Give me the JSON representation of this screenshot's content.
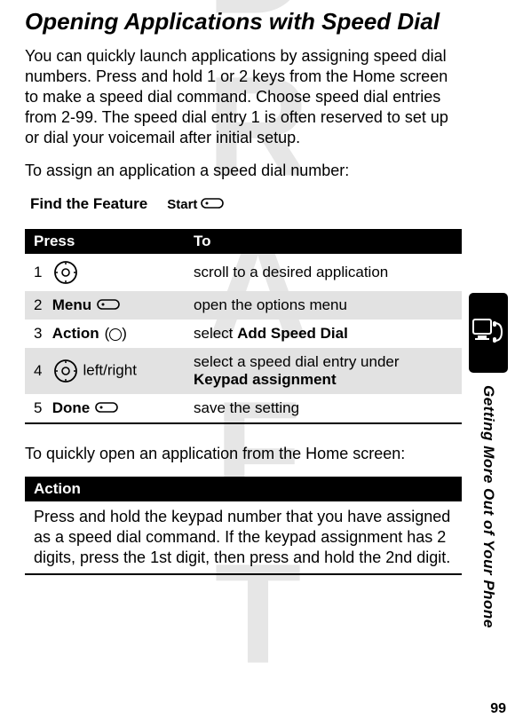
{
  "watermark": "DRAFT",
  "title": "Opening Applications with Speed Dial",
  "intro": "You can quickly launch applications by assigning speed dial numbers. Press and hold 1 or 2 keys from the Home screen to make a speed dial command. Choose speed dial entries from 2-99. The speed dial entry 1 is often reserved to set up or dial your voicemail after initial setup.",
  "assignLine": "To assign an application a speed dial number:",
  "feature": {
    "label": "Find the Feature",
    "start": "Start"
  },
  "table": {
    "headers": {
      "press": "Press",
      "to": "To"
    },
    "rows": [
      {
        "num": "1",
        "press": "",
        "to": "scroll to a desired application",
        "extra": ""
      },
      {
        "num": "2",
        "press": "Menu",
        "to": "open the options menu",
        "extra": ""
      },
      {
        "num": "3",
        "press": "Action",
        "to_prefix": "select ",
        "to_bold": "Add Speed Dial"
      },
      {
        "num": "4",
        "press_suffix": " left/right",
        "to_prefix": "select a speed dial entry under ",
        "to_bold": "Keypad assignment"
      },
      {
        "num": "5",
        "press": "Done",
        "to": "save the setting"
      }
    ]
  },
  "openLine": "To quickly open an application from the Home screen:",
  "action": {
    "header": "Action",
    "text": "Press and hold the keypad number that you have assigned as a speed dial command. If the keypad assignment has 2 digits, press the 1st digit, then press and hold the 2nd digit."
  },
  "sideTitle": "Getting More Out of Your Phone",
  "pageNum": "99"
}
